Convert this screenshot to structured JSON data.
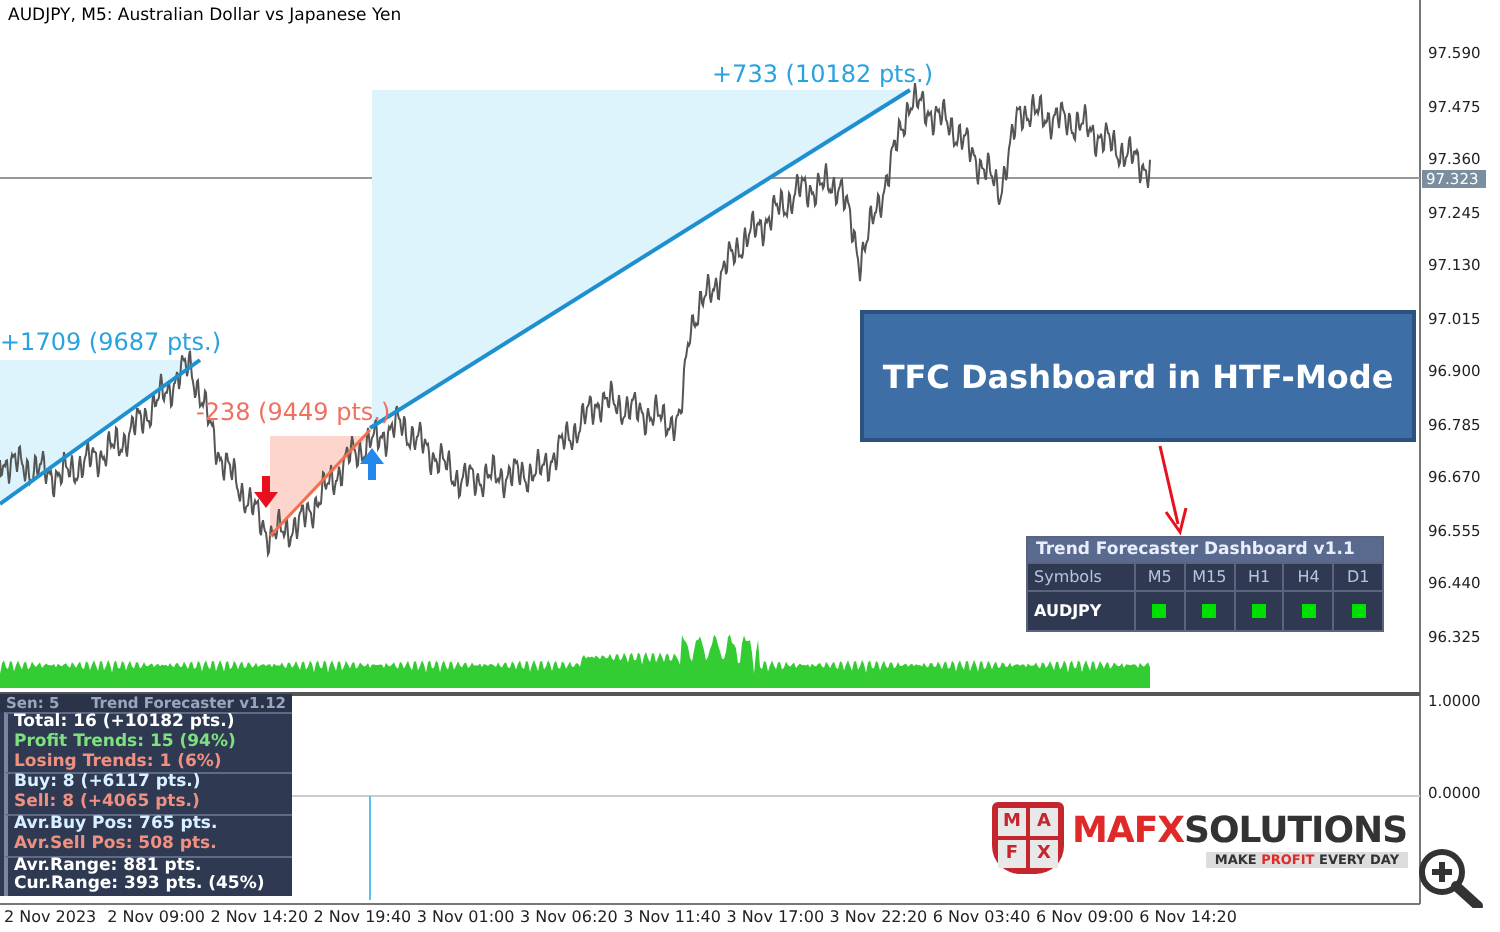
{
  "chart": {
    "title": "AUDJPY, M5:  Australian Dollar vs Japanese Yen",
    "price_labels": [
      "97.590",
      "97.475",
      "97.360",
      "97.245",
      "97.130",
      "97.015",
      "96.900",
      "96.785",
      "96.670",
      "96.555",
      "96.440",
      "96.325"
    ],
    "current_price": "97.323",
    "time_labels": [
      "2 Nov 2023",
      "2 Nov 09:00",
      "2 Nov 14:20",
      "2 Nov 19:40",
      "3 Nov 01:00",
      "3 Nov 06:20",
      "3 Nov 11:40",
      "3 Nov 17:00",
      "3 Nov 22:20",
      "6 Nov 03:40",
      "6 Nov 09:00",
      "6 Nov 14:20"
    ],
    "trends": [
      {
        "label": "+1709 (9687 pts.)",
        "kind": "profit"
      },
      {
        "label": "-238 (9449 pts.)",
        "kind": "loss"
      },
      {
        "label": "+733 (10182 pts.)",
        "kind": "profit"
      }
    ],
    "callout": "TFC Dashboard in HTF-Mode"
  },
  "dashboard": {
    "title": "Trend Forecaster Dashboard v1.1",
    "columns": [
      "Symbols",
      "M5",
      "M15",
      "H1",
      "H4",
      "D1"
    ],
    "rows": [
      {
        "symbol": "AUDJPY",
        "signals": [
          {
            "color": "#00e000"
          },
          {
            "color": "#00e000"
          },
          {
            "color": "#00e000"
          },
          {
            "color": "#00e000"
          },
          {
            "color": "#00e000"
          }
        ]
      }
    ]
  },
  "indicator": {
    "scale": [
      "1.0000",
      "0.0000"
    ],
    "panel": {
      "sensitivity": "Sen: 5",
      "title": "Trend Forecaster v1.12",
      "groups": [
        [
          {
            "text": "Total: 16 (+10182 pts.)",
            "color": "#ffffff"
          },
          {
            "text": "Profit Trends: 15 (94%)",
            "color": "#7ee07e"
          },
          {
            "text": "Losing Trends: 1 (6%)",
            "color": "#f09080"
          }
        ],
        [
          {
            "text": "Buy: 8 (+6117 pts.)",
            "color": "#d8f0ff"
          },
          {
            "text": "Sell: 8 (+4065 pts.)",
            "color": "#f09080"
          }
        ],
        [
          {
            "text": "Avr.Buy Pos: 765 pts.",
            "color": "#d8f0ff"
          },
          {
            "text": "Avr.Sell Pos: 508 pts.",
            "color": "#f09080"
          }
        ],
        [
          {
            "text": "Avr.Range: 881 pts.",
            "color": "#ffffff"
          },
          {
            "text": "Cur.Range: 393 pts. (45%)",
            "color": "#ffffff"
          }
        ]
      ]
    }
  },
  "logo": {
    "shield": [
      "M",
      "A",
      "F",
      "X"
    ],
    "brand": [
      {
        "text": "MAFX",
        "color": "#e02a2a"
      },
      {
        "text": "SOLUTIONS",
        "color": "#333333"
      }
    ],
    "tagline": [
      {
        "text": "MAKE ",
        "color": "#333333"
      },
      {
        "text": "PROFIT",
        "color": "#e02a2a"
      },
      {
        "text": " EVERY DAY",
        "color": "#333333"
      }
    ]
  }
}
